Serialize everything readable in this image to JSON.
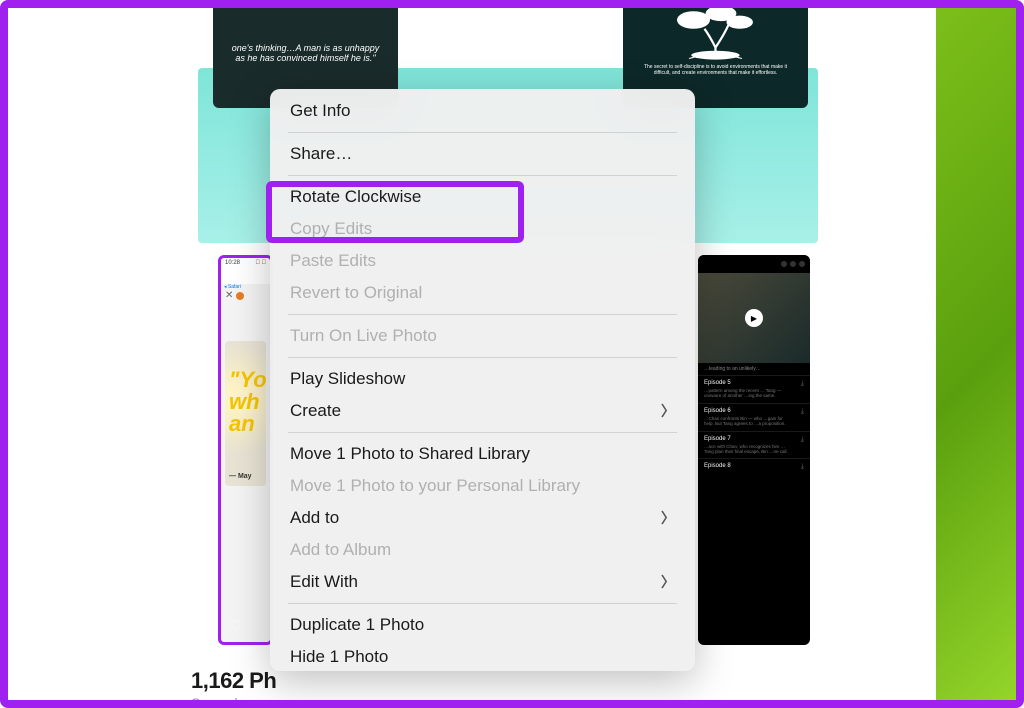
{
  "photos_title": "1,162 Ph",
  "synced_text": "Synced w",
  "top_left_quote": "one's thinking…A man is as unhappy as he has convinced himself he is.\"",
  "top_right_caption": "The secret to self-discipline is to avoid environments that make it difficult, and create environments that make it effortless.",
  "bottom_left": {
    "time": "10:28",
    "safari": "◂ Safari",
    "quote_lines": [
      "\"Yo",
      "wh",
      "an"
    ],
    "author": "— May"
  },
  "bottom_right": {
    "tagline": "…leading to an unlikely…",
    "episodes": [
      {
        "title": "Episode 5",
        "desc": "…pattern among the recent … Tang — unaware of another …ing the same."
      },
      {
        "title": "Episode 6",
        "desc": "…Chan confronts Bin — who …gain for help. But Tang agrees to …a proposition."
      },
      {
        "title": "Episode 7",
        "desc": "…ace with Chan, who recognizes him … Tang plan their final escape, Bin …ne call."
      },
      {
        "title": "Episode 8",
        "desc": ""
      }
    ]
  },
  "menu": {
    "get_info": "Get Info",
    "share": "Share…",
    "rotate_cw": "Rotate Clockwise",
    "copy_edits": "Copy Edits",
    "paste_edits": "Paste Edits",
    "revert": "Revert to Original",
    "live_photo": "Turn On Live Photo",
    "play_slideshow": "Play Slideshow",
    "create": "Create",
    "move_shared": "Move 1 Photo to Shared Library",
    "move_personal": "Move 1 Photo to your Personal Library",
    "add_to": "Add to",
    "add_album": "Add to Album",
    "edit_with": "Edit With",
    "duplicate": "Duplicate 1 Photo",
    "hide": "Hide 1 Photo"
  }
}
